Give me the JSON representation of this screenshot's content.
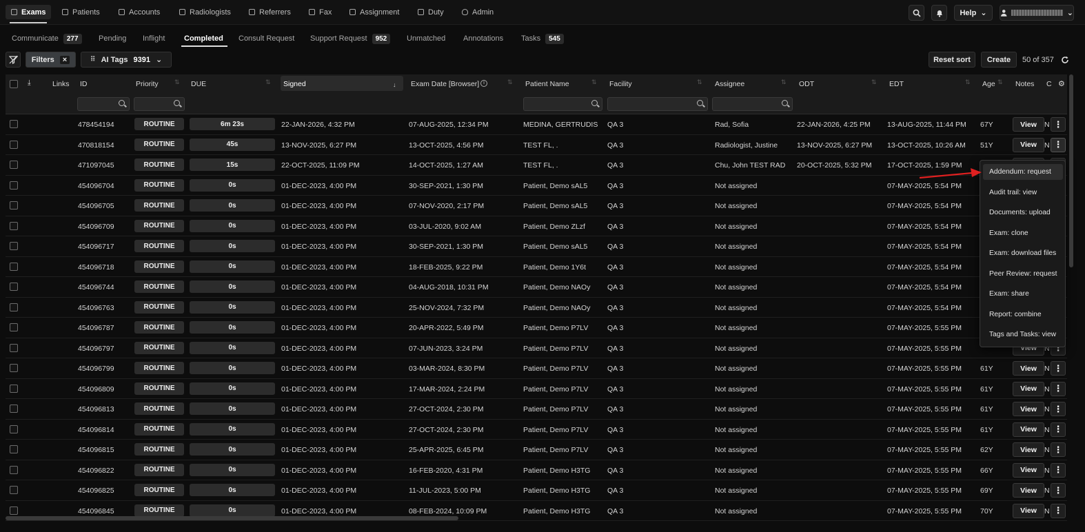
{
  "nav": {
    "items": [
      {
        "label": "Exams",
        "icon": "list-icon",
        "active": true
      },
      {
        "label": "Patients",
        "icon": "users-icon"
      },
      {
        "label": "Accounts",
        "icon": "building-icon"
      },
      {
        "label": "Radiologists",
        "icon": "doctor-icon"
      },
      {
        "label": "Referrers",
        "icon": "card-icon"
      },
      {
        "label": "Fax",
        "icon": "fax-icon"
      },
      {
        "label": "Assignment",
        "icon": "check-square-icon"
      },
      {
        "label": "Duty",
        "icon": "briefcase-icon"
      },
      {
        "label": "Admin",
        "icon": "shield-icon"
      }
    ],
    "help_label": "Help"
  },
  "tabs": [
    {
      "label": "Communicate",
      "count": "277"
    },
    {
      "label": "Pending",
      "count": ""
    },
    {
      "label": "Inflight",
      "count": ""
    },
    {
      "label": "Completed",
      "count": "",
      "active": true
    },
    {
      "label": "Consult Request",
      "count": ""
    },
    {
      "label": "Support Request",
      "count": "952"
    },
    {
      "label": "Unmatched",
      "count": ""
    },
    {
      "label": "Annotations",
      "count": ""
    },
    {
      "label": "Tasks",
      "count": "545"
    }
  ],
  "toolbar": {
    "filters_label": "Filters",
    "ai_tags_label": "AI Tags",
    "ai_tags_count": "9391",
    "reset_sort_label": "Reset sort",
    "create_label": "Create",
    "page_count": "50 of 357"
  },
  "columns": {
    "links": "Links",
    "id": "ID",
    "priority": "Priority",
    "due": "DUE",
    "signed": "Signed",
    "exam_date": "Exam Date [Browser]",
    "patient": "Patient Name",
    "facility": "Facility",
    "assignee": "Assignee",
    "odt": "ODT",
    "edt": "EDT",
    "age": "Age",
    "notes": "Notes",
    "extra": "C"
  },
  "rows": [
    {
      "id": "478454194",
      "priority": "ROUTINE",
      "due": "6m 23s",
      "signed": "22-JAN-2026, 4:32 PM",
      "exam_date": "07-AUG-2025, 12:34 PM",
      "patient": "MEDINA, GERTRUDIS",
      "facility": "QA 3",
      "assignee": "Rad, Sofia",
      "odt": "22-JAN-2026, 4:25 PM",
      "edt": "13-AUG-2025, 11:44 PM",
      "age": "67Y"
    },
    {
      "id": "470818154",
      "priority": "ROUTINE",
      "due": "45s",
      "signed": "13-NOV-2025, 6:27 PM",
      "exam_date": "13-OCT-2025, 4:56 PM",
      "patient": "TEST FL, .",
      "facility": "QA 3",
      "assignee": "Radiologist, Justine",
      "odt": "13-NOV-2025, 6:27 PM",
      "edt": "13-OCT-2025, 10:26 AM",
      "age": "51Y"
    },
    {
      "id": "471097045",
      "priority": "ROUTINE",
      "due": "15s",
      "signed": "22-OCT-2025, 11:09 PM",
      "exam_date": "14-OCT-2025, 1:27 AM",
      "patient": "TEST FL, .",
      "facility": "QA 3",
      "assignee": "Chu, John TEST RAD",
      "odt": "20-OCT-2025, 5:32 PM",
      "edt": "17-OCT-2025, 1:59 PM",
      "age": ""
    },
    {
      "id": "454096704",
      "priority": "ROUTINE",
      "due": "0s",
      "signed": "01-DEC-2023, 4:00 PM",
      "exam_date": "30-SEP-2021, 1:30 PM",
      "patient": "Patient, Demo sAL5",
      "facility": "QA 3",
      "assignee": "Not assigned",
      "odt": "",
      "edt": "07-MAY-2025, 5:54 PM",
      "age": ""
    },
    {
      "id": "454096705",
      "priority": "ROUTINE",
      "due": "0s",
      "signed": "01-DEC-2023, 4:00 PM",
      "exam_date": "07-NOV-2020, 2:17 PM",
      "patient": "Patient, Demo sAL5",
      "facility": "QA 3",
      "assignee": "Not assigned",
      "odt": "",
      "edt": "07-MAY-2025, 5:54 PM",
      "age": ""
    },
    {
      "id": "454096709",
      "priority": "ROUTINE",
      "due": "0s",
      "signed": "01-DEC-2023, 4:00 PM",
      "exam_date": "03-JUL-2020, 9:02 AM",
      "patient": "Patient, Demo ZLzf",
      "facility": "QA 3",
      "assignee": "Not assigned",
      "odt": "",
      "edt": "07-MAY-2025, 5:54 PM",
      "age": ""
    },
    {
      "id": "454096717",
      "priority": "ROUTINE",
      "due": "0s",
      "signed": "01-DEC-2023, 4:00 PM",
      "exam_date": "30-SEP-2021, 1:30 PM",
      "patient": "Patient, Demo sAL5",
      "facility": "QA 3",
      "assignee": "Not assigned",
      "odt": "",
      "edt": "07-MAY-2025, 5:54 PM",
      "age": ""
    },
    {
      "id": "454096718",
      "priority": "ROUTINE",
      "due": "0s",
      "signed": "01-DEC-2023, 4:00 PM",
      "exam_date": "18-FEB-2025, 9:22 PM",
      "patient": "Patient, Demo 1Y6t",
      "facility": "QA 3",
      "assignee": "Not assigned",
      "odt": "",
      "edt": "07-MAY-2025, 5:54 PM",
      "age": ""
    },
    {
      "id": "454096744",
      "priority": "ROUTINE",
      "due": "0s",
      "signed": "01-DEC-2023, 4:00 PM",
      "exam_date": "04-AUG-2018, 10:31 PM",
      "patient": "Patient, Demo NAOy",
      "facility": "QA 3",
      "assignee": "Not assigned",
      "odt": "",
      "edt": "07-MAY-2025, 5:54 PM",
      "age": ""
    },
    {
      "id": "454096763",
      "priority": "ROUTINE",
      "due": "0s",
      "signed": "01-DEC-2023, 4:00 PM",
      "exam_date": "25-NOV-2024, 7:32 PM",
      "patient": "Patient, Demo NAOy",
      "facility": "QA 3",
      "assignee": "Not assigned",
      "odt": "",
      "edt": "07-MAY-2025, 5:54 PM",
      "age": ""
    },
    {
      "id": "454096787",
      "priority": "ROUTINE",
      "due": "0s",
      "signed": "01-DEC-2023, 4:00 PM",
      "exam_date": "20-APR-2022, 5:49 PM",
      "patient": "Patient, Demo P7LV",
      "facility": "QA 3",
      "assignee": "Not assigned",
      "odt": "",
      "edt": "07-MAY-2025, 5:55 PM",
      "age": ""
    },
    {
      "id": "454096797",
      "priority": "ROUTINE",
      "due": "0s",
      "signed": "01-DEC-2023, 4:00 PM",
      "exam_date": "07-JUN-2023, 3:24 PM",
      "patient": "Patient, Demo P7LV",
      "facility": "QA 3",
      "assignee": "Not assigned",
      "odt": "",
      "edt": "07-MAY-2025, 5:55 PM",
      "age": ""
    },
    {
      "id": "454096799",
      "priority": "ROUTINE",
      "due": "0s",
      "signed": "01-DEC-2023, 4:00 PM",
      "exam_date": "03-MAR-2024, 8:30 PM",
      "patient": "Patient, Demo P7LV",
      "facility": "QA 3",
      "assignee": "Not assigned",
      "odt": "",
      "edt": "07-MAY-2025, 5:55 PM",
      "age": "61Y"
    },
    {
      "id": "454096809",
      "priority": "ROUTINE",
      "due": "0s",
      "signed": "01-DEC-2023, 4:00 PM",
      "exam_date": "17-MAR-2024, 2:24 PM",
      "patient": "Patient, Demo P7LV",
      "facility": "QA 3",
      "assignee": "Not assigned",
      "odt": "",
      "edt": "07-MAY-2025, 5:55 PM",
      "age": "61Y"
    },
    {
      "id": "454096813",
      "priority": "ROUTINE",
      "due": "0s",
      "signed": "01-DEC-2023, 4:00 PM",
      "exam_date": "27-OCT-2024, 2:30 PM",
      "patient": "Patient, Demo P7LV",
      "facility": "QA 3",
      "assignee": "Not assigned",
      "odt": "",
      "edt": "07-MAY-2025, 5:55 PM",
      "age": "61Y"
    },
    {
      "id": "454096814",
      "priority": "ROUTINE",
      "due": "0s",
      "signed": "01-DEC-2023, 4:00 PM",
      "exam_date": "27-OCT-2024, 2:30 PM",
      "patient": "Patient, Demo P7LV",
      "facility": "QA 3",
      "assignee": "Not assigned",
      "odt": "",
      "edt": "07-MAY-2025, 5:55 PM",
      "age": "61Y"
    },
    {
      "id": "454096815",
      "priority": "ROUTINE",
      "due": "0s",
      "signed": "01-DEC-2023, 4:00 PM",
      "exam_date": "25-APR-2025, 6:45 PM",
      "patient": "Patient, Demo P7LV",
      "facility": "QA 3",
      "assignee": "Not assigned",
      "odt": "",
      "edt": "07-MAY-2025, 5:55 PM",
      "age": "62Y"
    },
    {
      "id": "454096822",
      "priority": "ROUTINE",
      "due": "0s",
      "signed": "01-DEC-2023, 4:00 PM",
      "exam_date": "16-FEB-2020, 4:31 PM",
      "patient": "Patient, Demo H3TG",
      "facility": "QA 3",
      "assignee": "Not assigned",
      "odt": "",
      "edt": "07-MAY-2025, 5:55 PM",
      "age": "66Y"
    },
    {
      "id": "454096825",
      "priority": "ROUTINE",
      "due": "0s",
      "signed": "01-DEC-2023, 4:00 PM",
      "exam_date": "11-JUL-2023, 5:00 PM",
      "patient": "Patient, Demo H3TG",
      "facility": "QA 3",
      "assignee": "Not assigned",
      "odt": "",
      "edt": "07-MAY-2025, 5:55 PM",
      "age": "69Y"
    },
    {
      "id": "454096845",
      "priority": "ROUTINE",
      "due": "0s",
      "signed": "01-DEC-2023, 4:00 PM",
      "exam_date": "08-FEB-2024, 10:09 PM",
      "patient": "Patient, Demo H3TG",
      "facility": "QA 3",
      "assignee": "Not assigned",
      "odt": "",
      "edt": "07-MAY-2025, 5:55 PM",
      "age": "70Y"
    }
  ],
  "row_view_label": "View",
  "row_notes_label": "N",
  "menu": {
    "items": [
      "Addendum: request",
      "Audit trail: view",
      "Documents: upload",
      "Exam: clone",
      "Exam: download files",
      "Peer Review: request",
      "Exam: share",
      "Report: combine",
      "Tags and Tasks: view"
    ]
  },
  "annotation_color": "#e02020"
}
